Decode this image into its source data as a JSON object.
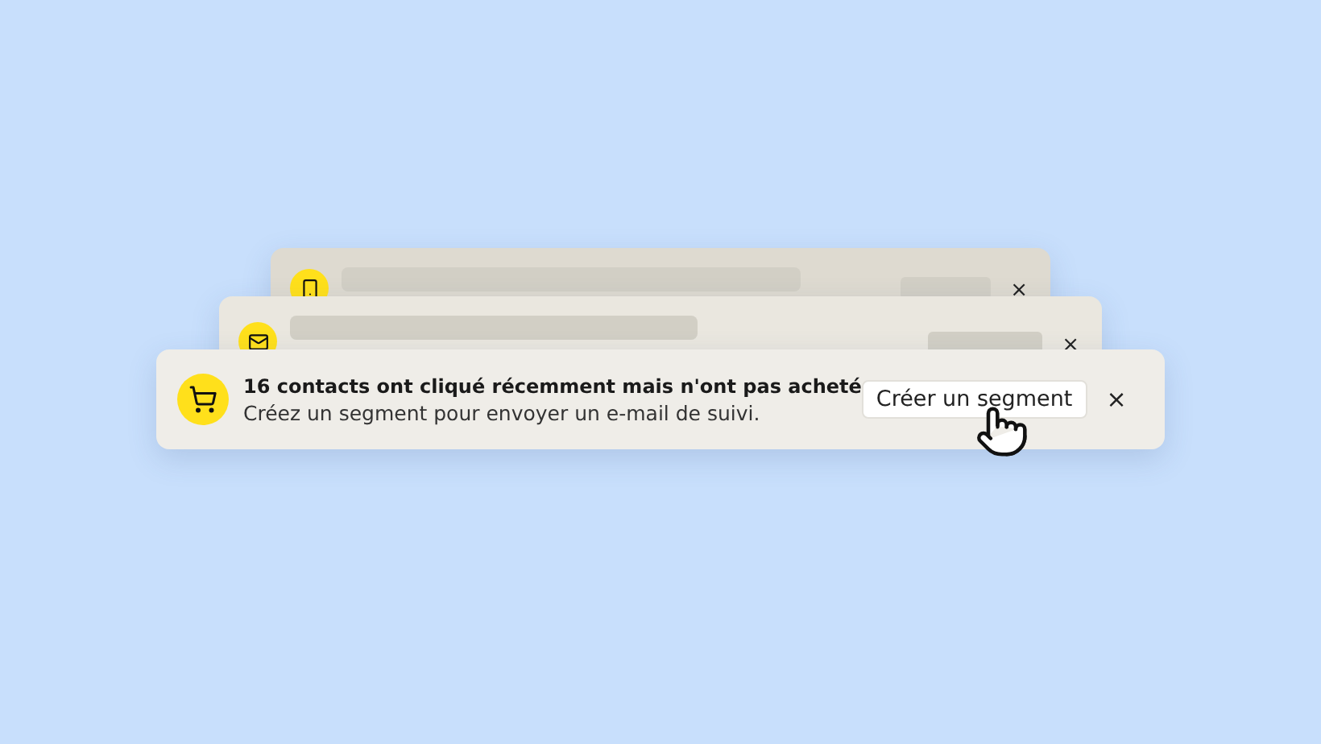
{
  "stacked_cards": [
    {
      "kind": "placeholder",
      "close": "×"
    },
    {
      "kind": "placeholder",
      "close": "×"
    },
    {
      "kind": "notification",
      "title": "16 contacts ont cliqué récemment mais n'ont pas acheté",
      "message": "Créez un segment pour envoyer un e-mail de suivi.",
      "button": "Créer un segment",
      "close": "×"
    }
  ]
}
